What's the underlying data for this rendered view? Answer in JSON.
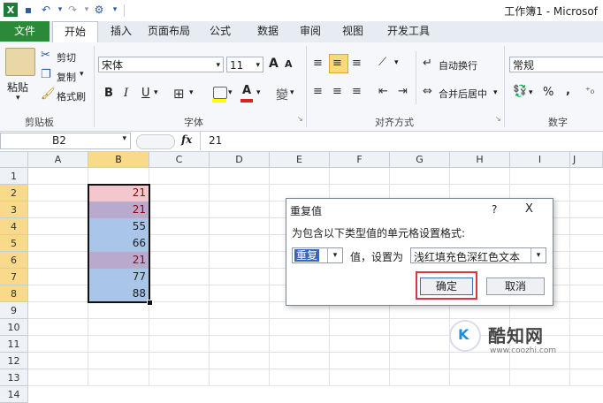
{
  "window": {
    "title": "工作簿1 - Microsof"
  },
  "tabs": [
    "文件",
    "开始",
    "插入",
    "页面布局",
    "公式",
    "数据",
    "审阅",
    "视图",
    "开发工具"
  ],
  "clipboard": {
    "paste": "粘贴",
    "cut": "剪切",
    "copy": "复制",
    "format_painter": "格式刷",
    "group_label": "剪贴板"
  },
  "font": {
    "name": "宋体",
    "size": "11",
    "grow": "A",
    "shrink": "A",
    "bold": "B",
    "italic": "I",
    "underline": "U",
    "group_label": "字体"
  },
  "alignment": {
    "wrap_text": "自动换行",
    "merge_center": "合并后居中",
    "group_label": "对齐方式"
  },
  "number": {
    "format": "常规",
    "percent": "%",
    "comma": ",",
    "group_label": "数字"
  },
  "formula_bar": {
    "name_box": "B2",
    "fx": "fx",
    "value": "21"
  },
  "columns": [
    "A",
    "B",
    "C",
    "D",
    "E",
    "F",
    "G",
    "H",
    "I",
    "J"
  ],
  "rows": [
    "1",
    "2",
    "3",
    "4",
    "5",
    "6",
    "7",
    "8",
    "9",
    "10",
    "11",
    "12",
    "13",
    "14"
  ],
  "cells_b": [
    {
      "value": "21",
      "dup": true
    },
    {
      "value": "21",
      "dup": true
    },
    {
      "value": "55",
      "dup": false
    },
    {
      "value": "66",
      "dup": false
    },
    {
      "value": "21",
      "dup": true
    },
    {
      "value": "77",
      "dup": false
    },
    {
      "value": "88",
      "dup": false
    }
  ],
  "dialog": {
    "title": "重复值",
    "help": "?",
    "close": "X",
    "prompt": "为包含以下类型值的单元格设置格式:",
    "type_value": "重复",
    "mid_text": "值，设置为",
    "format_value": "浅红填充色深红色文本",
    "ok": "确定",
    "cancel": "取消"
  },
  "watermark": {
    "brand": "酷知网",
    "url": "www.coozhi.com"
  },
  "colors": {
    "dup_fill": "#f4c7ce",
    "dup_text": "#9c0006",
    "sel_fill": "#a9c6e8",
    "file_tab": "#2a8a3a",
    "highlight_box": "#d9363e"
  }
}
